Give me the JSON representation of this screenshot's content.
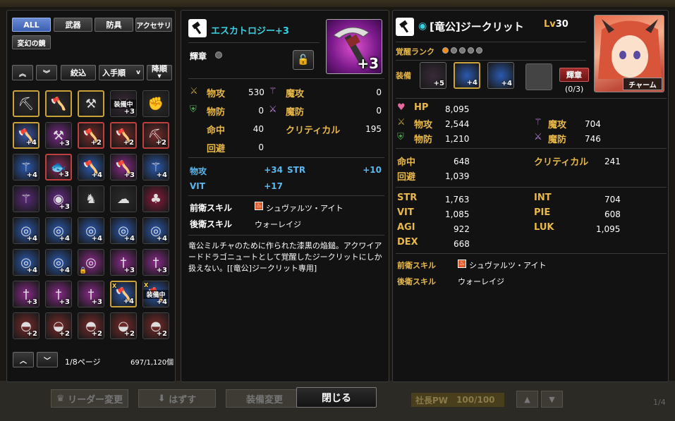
{
  "left": {
    "categories": [
      "ALL",
      "武器",
      "防具",
      "アクセサリ",
      "変幻の鏡"
    ],
    "filter_label": "絞込",
    "sort_label": "入手順",
    "sort_arrow": "v",
    "order_label": "降順",
    "page_label": "1/8ページ",
    "count_label": "697/1,120個",
    "items": [
      {
        "plus": "",
        "frame": "gold",
        "icon": "pickaxe-icon",
        "bg": "#2a2a2a"
      },
      {
        "plus": "",
        "frame": "gold",
        "icon": "axe-icon",
        "bg": "#2a2a2a"
      },
      {
        "plus": "",
        "frame": "gold",
        "icon": "hammer-icon",
        "bg": "#2a2a2a"
      },
      {
        "plus": "+3",
        "frame": "plain",
        "icon": "scythe-icon",
        "bg": "#3a2a3a",
        "equipped": "装備中"
      },
      {
        "plus": "",
        "frame": "plain",
        "icon": "gauntlet-icon",
        "bg": "#2c2c2c"
      },
      {
        "plus": "+4",
        "frame": "gold",
        "icon": "axe-icon",
        "bg": "#3a55a8"
      },
      {
        "plus": "+3",
        "frame": "plain",
        "icon": "hammer-icon",
        "bg": "#7a2a8a"
      },
      {
        "plus": "+2",
        "frame": "red",
        "icon": "axe-icon",
        "bg": "#7a2a2a"
      },
      {
        "plus": "+2",
        "frame": "red",
        "icon": "axe-icon",
        "bg": "#7a2a2a"
      },
      {
        "plus": "+2",
        "frame": "red",
        "icon": "pickaxe-icon",
        "bg": "#7a2a2a"
      },
      {
        "plus": "+4",
        "frame": "plain",
        "icon": "staff-icon",
        "bg": "#2a5ab0"
      },
      {
        "plus": "+3",
        "frame": "red",
        "icon": "fish-icon",
        "bg": "#8a2a5a"
      },
      {
        "plus": "+4",
        "frame": "plain",
        "icon": "axe-icon",
        "bg": "#2a5ab0"
      },
      {
        "plus": "+3",
        "frame": "plain",
        "icon": "axe-icon",
        "bg": "#8a2a8a"
      },
      {
        "plus": "+4",
        "frame": "plain",
        "icon": "staff-icon",
        "bg": "#2a5ab0"
      },
      {
        "plus": "",
        "frame": "plain",
        "icon": "staff-icon",
        "bg": "#5a2a7a"
      },
      {
        "plus": "+3",
        "frame": "plain",
        "icon": "orb-icon",
        "bg": "#6a2a8a"
      },
      {
        "plus": "",
        "frame": "plain",
        "icon": "figure-icon",
        "bg": "#2c2c2c"
      },
      {
        "plus": "",
        "frame": "plain",
        "icon": "ghost-icon",
        "bg": "#2c2c2c"
      },
      {
        "plus": "",
        "frame": "plain",
        "icon": "bag-icon",
        "bg": "#8a1a3a"
      },
      {
        "plus": "+4",
        "frame": "plain",
        "icon": "ring-icon",
        "bg": "#2a5ab0"
      },
      {
        "plus": "+4",
        "frame": "plain",
        "icon": "ring-icon",
        "bg": "#2a5ab0"
      },
      {
        "plus": "+4",
        "frame": "plain",
        "icon": "ring-icon",
        "bg": "#2a5ab0"
      },
      {
        "plus": "+4",
        "frame": "plain",
        "icon": "ring-icon",
        "bg": "#2a5ab0"
      },
      {
        "plus": "+4",
        "frame": "plain",
        "icon": "ring-icon",
        "bg": "#2a5ab0"
      },
      {
        "plus": "+4",
        "frame": "plain",
        "icon": "ring-icon",
        "bg": "#2a5ab0"
      },
      {
        "plus": "+4",
        "frame": "plain",
        "icon": "ring-icon",
        "bg": "#2a5ab0"
      },
      {
        "plus": "",
        "frame": "plain",
        "icon": "ring-icon",
        "bg": "#8a2a8a",
        "lock": true
      },
      {
        "plus": "+3",
        "frame": "plain",
        "icon": "dagger-icon",
        "bg": "#8a2a8a"
      },
      {
        "plus": "+3",
        "frame": "plain",
        "icon": "dagger-icon",
        "bg": "#8a2a8a"
      },
      {
        "plus": "+3",
        "frame": "plain",
        "icon": "dagger-icon",
        "bg": "#8a2a8a"
      },
      {
        "plus": "+3",
        "frame": "plain",
        "icon": "dagger-icon",
        "bg": "#8a2a8a"
      },
      {
        "plus": "+3",
        "frame": "plain",
        "icon": "dagger-icon",
        "bg": "#8a2a8a"
      },
      {
        "plus": "+4",
        "frame": "gold",
        "icon": "axe-icon",
        "bg": "#2a5ab0",
        "mark": "X"
      },
      {
        "plus": "+4",
        "frame": "plain",
        "icon": "axe-icon",
        "bg": "#2a5ab0",
        "equipped": "装備中",
        "mark": "X"
      },
      {
        "plus": "+2",
        "frame": "plain",
        "icon": "helmet-icon",
        "bg": "#7a2a2a"
      },
      {
        "plus": "+2",
        "frame": "plain",
        "icon": "cap-icon",
        "bg": "#7a2a2a"
      },
      {
        "plus": "+2",
        "frame": "plain",
        "icon": "helmet-icon",
        "bg": "#7a2a2a"
      },
      {
        "plus": "+2",
        "frame": "plain",
        "icon": "cap-icon",
        "bg": "#7a2a2a"
      },
      {
        "plus": "+2",
        "frame": "plain",
        "icon": "helmet-icon",
        "bg": "#7a2a2a"
      }
    ]
  },
  "item": {
    "name": "エスカトロジー+3",
    "plus_badge": "+3",
    "emblem_label": "輝章",
    "stats": {
      "patk_label": "物攻",
      "patk": "530",
      "matk_label": "魔攻",
      "matk": "0",
      "pdef_label": "物防",
      "pdef": "0",
      "mdef_label": "魔防",
      "mdef": "0",
      "hit_label": "命中",
      "hit": "40",
      "crit_label": "クリティカル",
      "crit": "195",
      "eva_label": "回避",
      "eva": "0"
    },
    "bonus": {
      "patk_label": "物攻",
      "patk": "+34",
      "str_label": "STR",
      "str": "+10",
      "vit_label": "VIT",
      "vit": "+17"
    },
    "front_skill_label": "前衛スキル",
    "front_skill": "シュヴァルツ・アイト",
    "back_skill_label": "後衛スキル",
    "back_skill": "ウォーレイジ",
    "description": "竜公ミルチャのために作られた漆黒の焔鎚。アクワイアードドラゴニュートとして覚醒したジークリットにしか扱えない。[[竜公]ジークリット専用]"
  },
  "character": {
    "name": "[竜公]ジークリット",
    "level_label": "Lv",
    "level": "30",
    "awaken_label": "覚醒ランク",
    "awaken_filled": 1,
    "awaken_total": 5,
    "equip_label": "装備",
    "equip_items": [
      {
        "plus": "+5",
        "bg": "#3a2a3a"
      },
      {
        "plus": "+4",
        "bg": "#2a5ab0"
      },
      {
        "plus": "+4",
        "bg": "#2a5ab0"
      }
    ],
    "emblem_btn": "輝章",
    "emblem_count": "(0/3)",
    "charm_btn": "チャーム",
    "hp_label": "HP",
    "hp": "8,095",
    "patk_label": "物攻",
    "patk": "2,544",
    "pdef_label": "物防",
    "pdef": "1,210",
    "matk_label": "魔攻",
    "matk": "704",
    "mdef_label": "魔防",
    "mdef": "746",
    "hit_label": "命中",
    "hit": "648",
    "eva_label": "回避",
    "eva": "1,039",
    "crit_label": "クリティカル",
    "crit": "241",
    "str_label": "STR",
    "str": "1,763",
    "vit_label": "VIT",
    "vit": "1,085",
    "agi_label": "AGI",
    "agi": "922",
    "dex_label": "DEX",
    "dex": "668",
    "int_label": "INT",
    "int": "704",
    "pie_label": "PIE",
    "pie": "608",
    "luk_label": "LUK",
    "luk": "1,095",
    "front_skill_label": "前衛スキル",
    "front_skill": "シュヴァルツ・アイト",
    "back_skill_label": "後衛スキル",
    "back_skill": "ウォーレイジ"
  },
  "footer": {
    "leader_change": "リーダー変更",
    "unequip": "はずす",
    "equip_change": "装備変更",
    "close": "閉じる",
    "pw_label": "社長PW",
    "pw_value": "100/100",
    "page": "1/4"
  },
  "colors": {
    "gold": "#e8b94a",
    "blue": "#5ab8f0",
    "active_tab": "#4a6ec4",
    "awaken_dot": "#f08a1a"
  }
}
